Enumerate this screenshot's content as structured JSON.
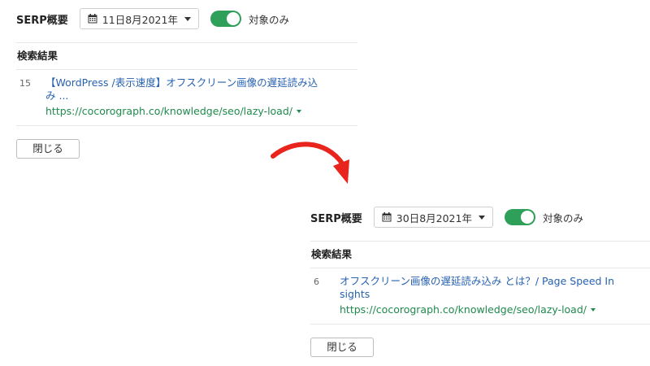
{
  "colors": {
    "toggle_on": "#2ea05a",
    "link": "#2762b0",
    "url": "#1f8a4d",
    "arrow": "#e8241c"
  },
  "before": {
    "serp_title": "SERP概要",
    "date_label": "11日8月2021年",
    "toggle_label": "対象のみ",
    "toggle_on": true,
    "section_title": "検索結果",
    "result": {
      "rank": "15",
      "title_line1": "【WordPress /表示速度】オフスクリーン画像の遅延読み込",
      "title_line2": "み ...",
      "url": "https://cocorograph.co/knowledge/seo/lazy-load/"
    },
    "close_label": "閉じる"
  },
  "after": {
    "serp_title": "SERP概要",
    "date_label": "30日8月2021年",
    "toggle_label": "対象のみ",
    "toggle_on": true,
    "section_title": "検索結果",
    "result": {
      "rank": "6",
      "title_line1": "オフスクリーン画像の遅延読み込み とは？/ Page Speed In",
      "title_line2": "sights",
      "url": "https://cocorograph.co/knowledge/seo/lazy-load/"
    },
    "close_label": "閉じる"
  }
}
